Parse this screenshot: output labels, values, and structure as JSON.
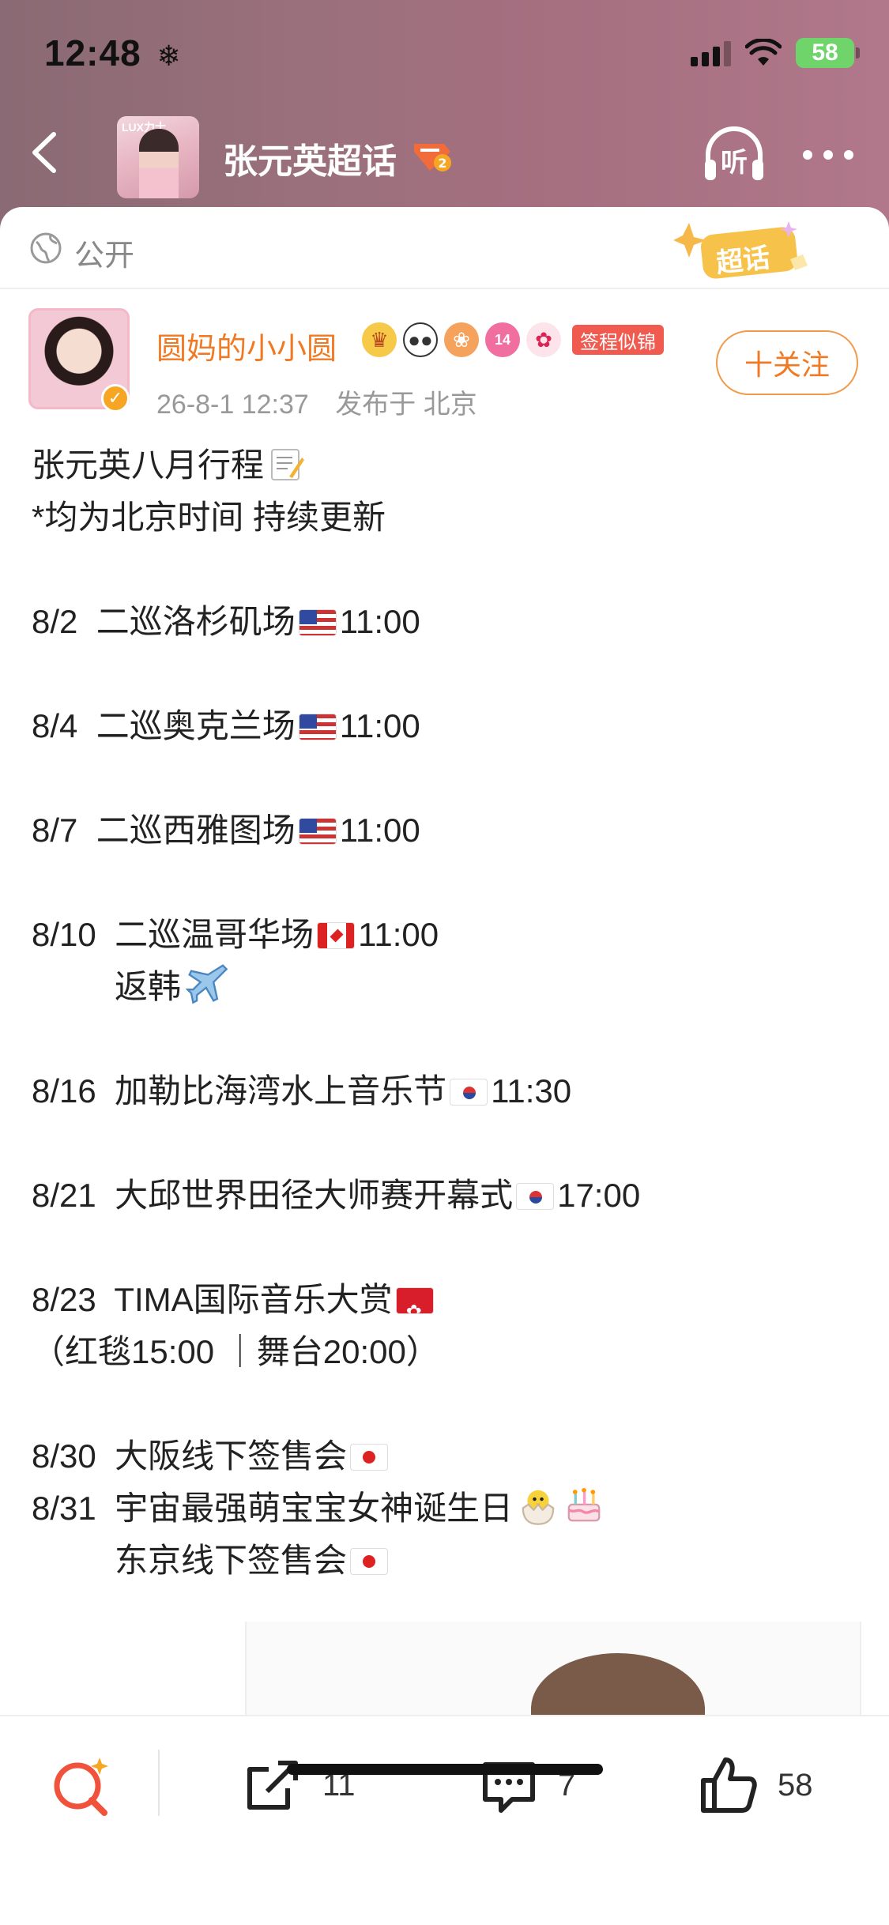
{
  "status_bar": {
    "time": "12:48",
    "battery": "58"
  },
  "nav": {
    "title": "张元英超话",
    "thumb_caption": "LUX力士",
    "listen_label": "听"
  },
  "visibility": {
    "label": "公开",
    "badge": "超话"
  },
  "author": {
    "name": "圆妈的小小圆",
    "tag": "签程似锦",
    "badge_level": "14",
    "date": "26-8-1 12:37",
    "location": "发布于 北京",
    "follow_label": "十关注"
  },
  "post": {
    "lines": [
      {
        "text": "张元英八月行程",
        "suffix": "",
        "icon": "memo"
      },
      {
        "text": "*均为北京时间 持续更新",
        "suffix": "",
        "icon": ""
      },
      {
        "text": "8/2  二巡洛杉矶场",
        "suffix": "11:00",
        "icon": "flag-us"
      },
      {
        "text": "8/4  二巡奥克兰场",
        "suffix": "11:00",
        "icon": "flag-us"
      },
      {
        "text": "8/7  二巡西雅图场",
        "suffix": "11:00",
        "icon": "flag-us"
      },
      {
        "text": "8/10  二巡温哥华场",
        "suffix": "11:00",
        "icon": "flag-ca"
      },
      {
        "text": "         返韩",
        "suffix": "",
        "icon": "airplane"
      },
      {
        "text": "8/16  加勒比海湾水上音乐节",
        "suffix": "11:30",
        "icon": "flag-kr"
      },
      {
        "text": "8/21  大邱世界田径大师赛开幕式",
        "suffix": "17:00",
        "icon": "flag-kr"
      },
      {
        "text": "8/23  TIMA国际音乐大赏",
        "suffix": "",
        "icon": "flag-hk"
      },
      {
        "text": "（红毯15:00 ｜舞台20:00）",
        "suffix": "",
        "icon": ""
      },
      {
        "text": "8/30  大阪线下签售会",
        "suffix": "",
        "icon": "flag-jp"
      },
      {
        "text": "8/31  宇宙最强萌宝宝女神诞生日",
        "suffix": "",
        "icon": "chick-cake"
      },
      {
        "text": "         东京线下签售会",
        "suffix": "",
        "icon": "flag-jp"
      }
    ]
  },
  "actions": {
    "share_count": "11",
    "comment_count": "7",
    "like_count": "58"
  },
  "colors": {
    "accent_orange": "#f07a24",
    "header_bg": "#9a707c"
  }
}
